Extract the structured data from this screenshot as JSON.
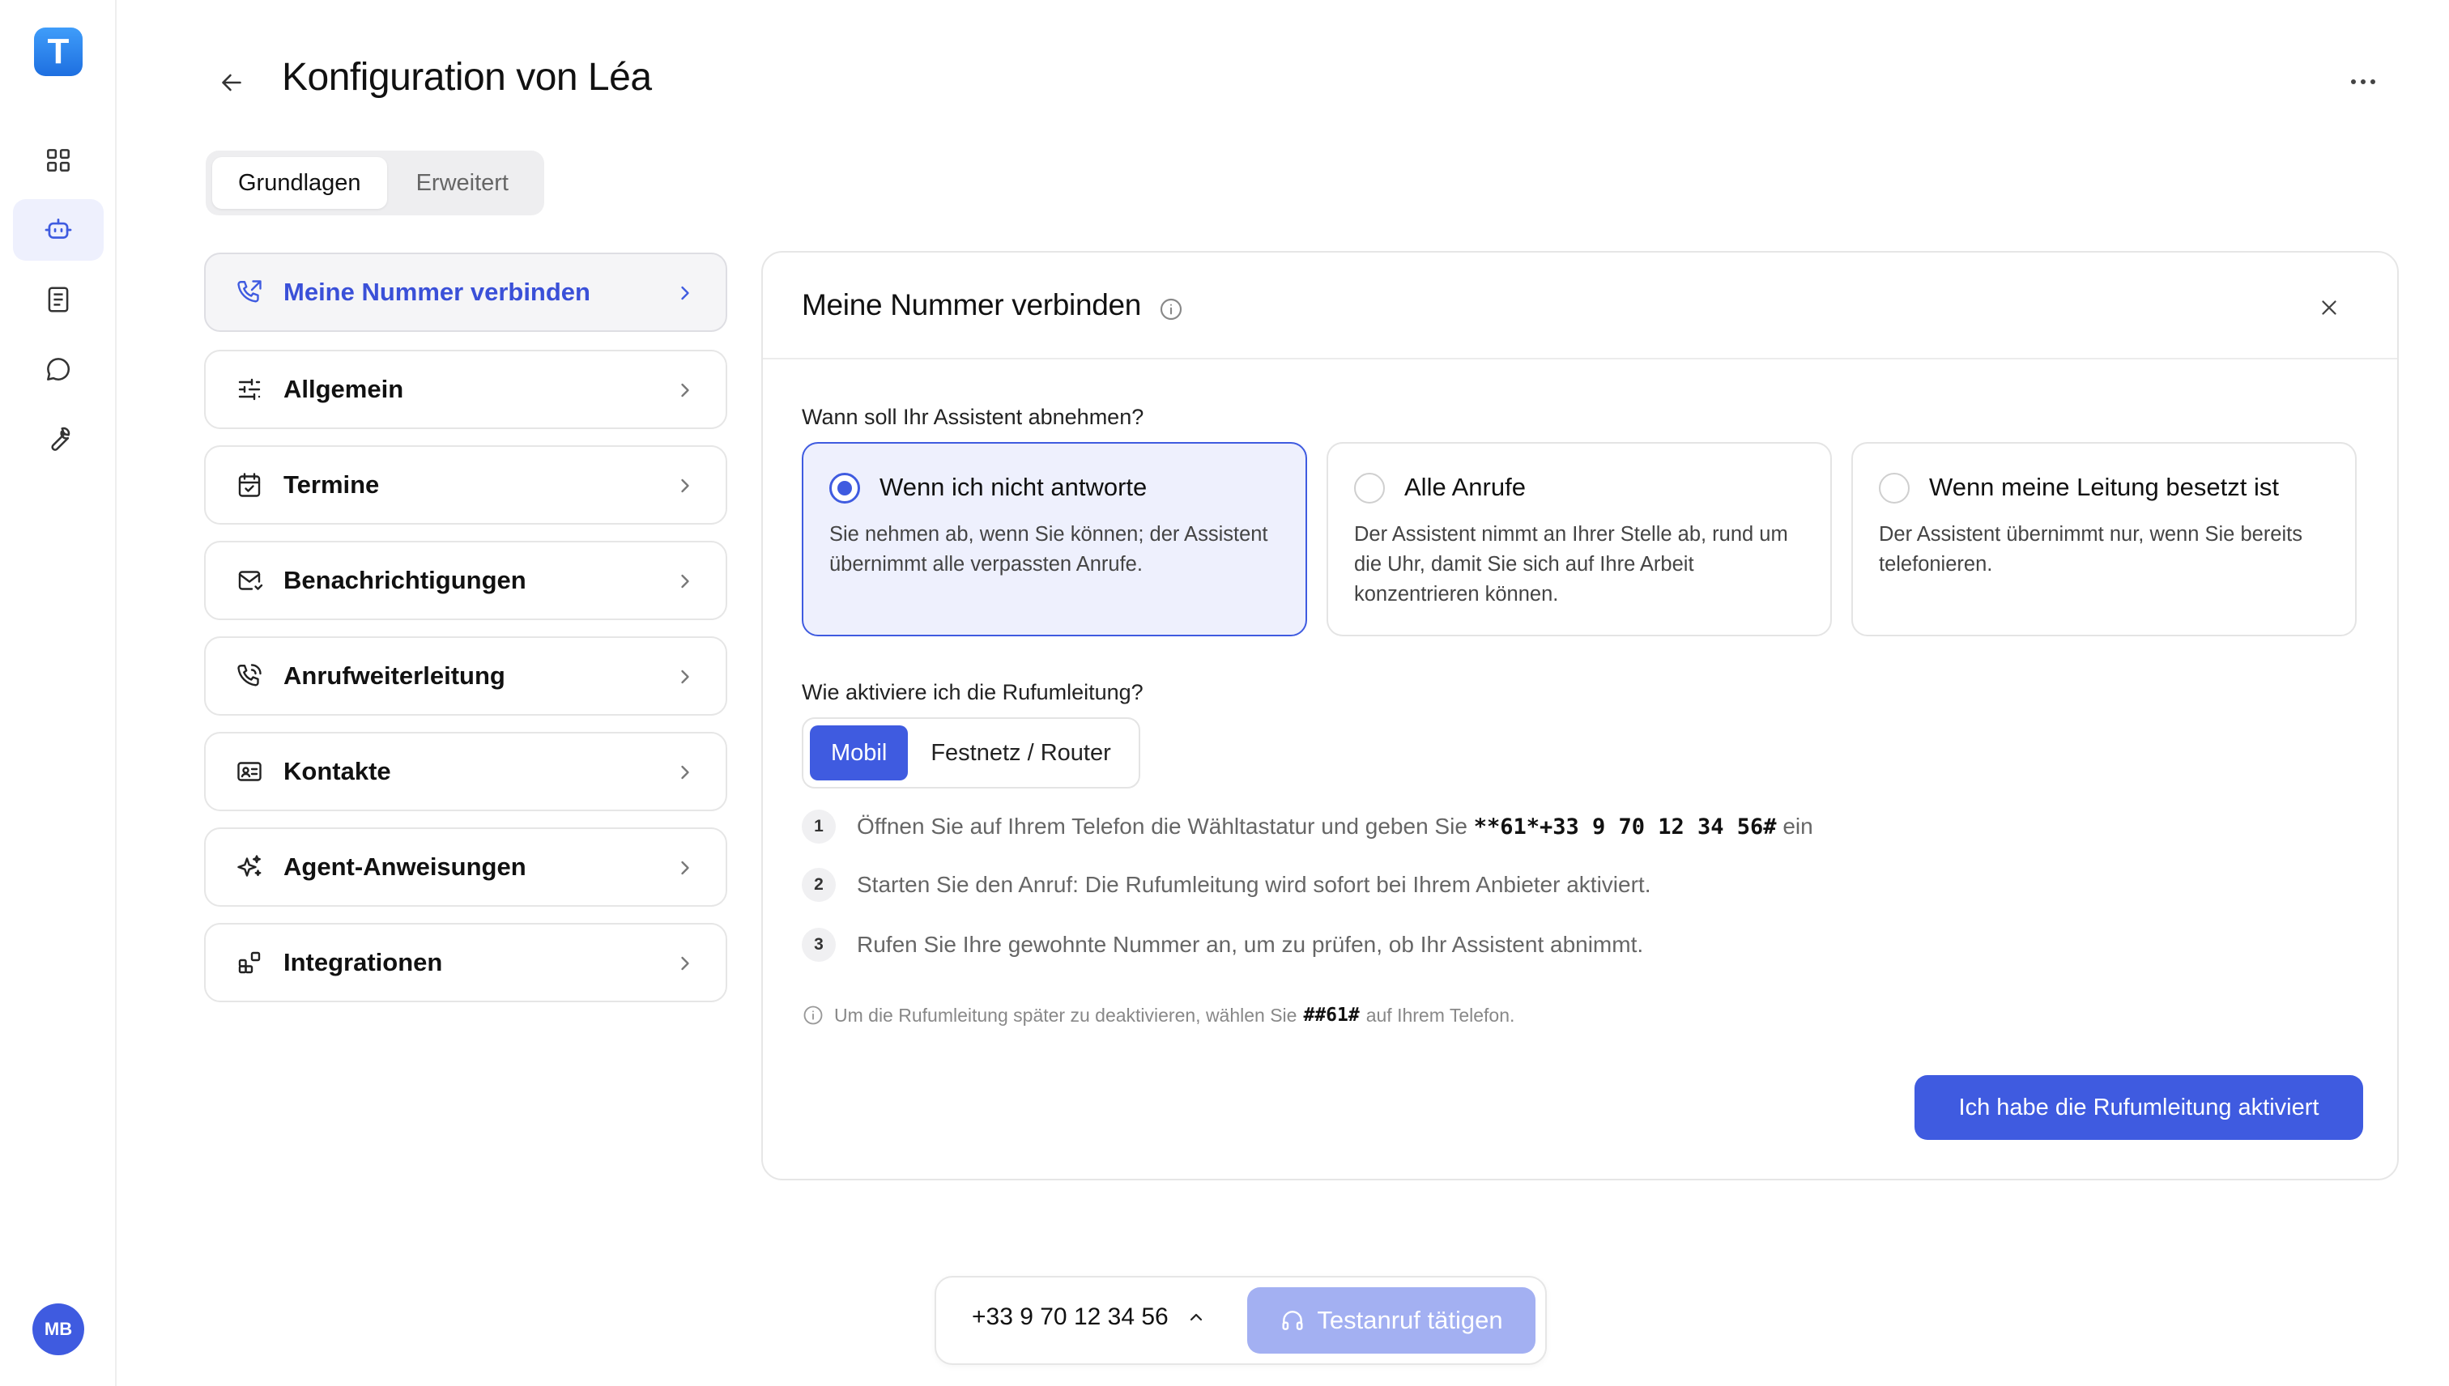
{
  "app": {
    "logo_letter": "T",
    "user_initials": "MB"
  },
  "header": {
    "title": "Konfiguration von Léa"
  },
  "tabs": [
    {
      "label": "Grundlagen",
      "active": true
    },
    {
      "label": "Erweitert",
      "active": false
    }
  ],
  "menu": [
    {
      "label": "Meine Nummer verbinden",
      "icon": "phone-forward-icon",
      "active": true
    },
    {
      "label": "Allgemein",
      "icon": "sliders-icon",
      "active": false
    },
    {
      "label": "Termine",
      "icon": "calendar-icon",
      "active": false
    },
    {
      "label": "Benachrichtigungen",
      "icon": "mail-icon",
      "active": false
    },
    {
      "label": "Anrufweiterleitung",
      "icon": "phone-call-icon",
      "active": false
    },
    {
      "label": "Kontakte",
      "icon": "contact-card-icon",
      "active": false
    },
    {
      "label": "Agent-Anweisungen",
      "icon": "sparkles-icon",
      "active": false
    },
    {
      "label": "Integrationen",
      "icon": "blocks-icon",
      "active": false
    }
  ],
  "panel": {
    "title": "Meine Nummer verbinden",
    "question_when": "Wann soll Ihr Assistent abnehmen?",
    "options": [
      {
        "title": "Wenn ich nicht antworte",
        "desc": "Sie nehmen ab, wenn Sie können; der Assistent übernimmt alle verpassten Anrufe.",
        "selected": true
      },
      {
        "title": "Alle Anrufe",
        "desc": "Der Assistent nimmt an Ihrer Stelle ab, rund um die Uhr, damit Sie sich auf Ihre Arbeit konzentrieren können.",
        "selected": false
      },
      {
        "title": "Wenn meine Leitung besetzt ist",
        "desc": "Der Assistent übernimmt nur, wenn Sie bereits telefonieren.",
        "selected": false
      }
    ],
    "question_how": "Wie aktiviere ich die Rufumleitung?",
    "segments": [
      {
        "label": "Mobil",
        "active": true
      },
      {
        "label": "Festnetz / Router",
        "active": false
      }
    ],
    "steps": [
      {
        "num": "1",
        "before": "Öffnen Sie auf Ihrem Telefon die Wähltastatur und geben Sie",
        "code": "**61*+33 9 70 12 34 56#",
        "after": "ein"
      },
      {
        "num": "2",
        "text": "Starten Sie den Anruf: Die Rufumleitung wird sofort bei Ihrem Anbieter aktiviert."
      },
      {
        "num": "3",
        "text": "Rufen Sie Ihre gewohnte Nummer an, um zu prüfen, ob Ihr Assistent abnimmt."
      }
    ],
    "note": {
      "before": "Um die Rufumleitung später zu deaktivieren, wählen Sie",
      "code": "##61#",
      "after": "auf Ihrem Telefon."
    },
    "cta_label": "Ich habe die Rufumleitung aktiviert"
  },
  "bottom_bar": {
    "phone_number": "+33 9 70 12 34 56",
    "test_call_label": "Testanruf tätigen"
  },
  "colors": {
    "accent": "#3f5be0",
    "accent_light": "#eef0fd",
    "accent_disabled": "#a3b0f2"
  }
}
